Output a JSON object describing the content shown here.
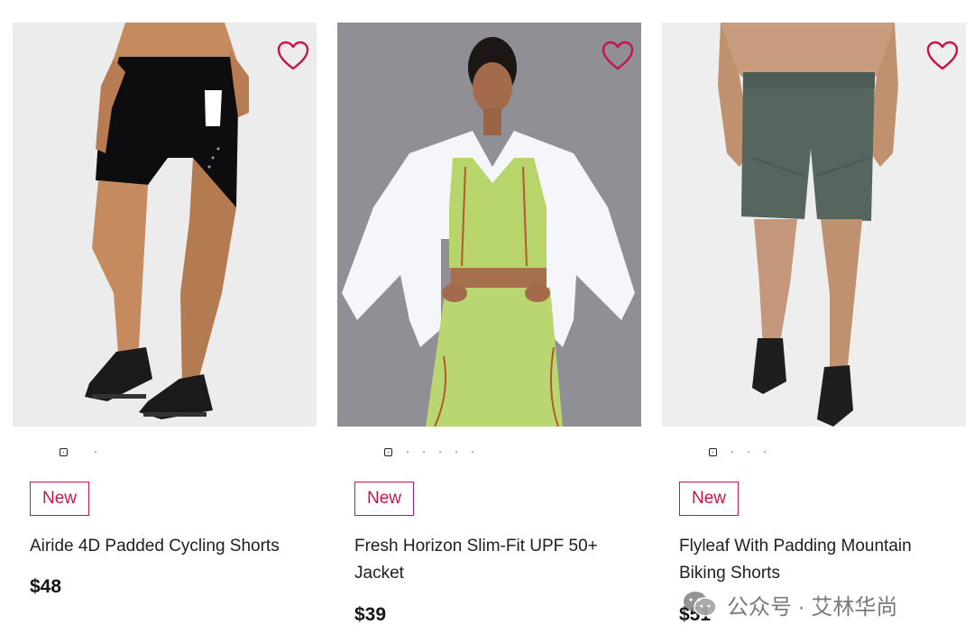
{
  "products": [
    {
      "badge": "New",
      "name": "Airide 4D Padded Cycling Shorts",
      "price": "$48",
      "image_icon": "cycling-shorts-photo",
      "favorite_icon": "heart-outline-icon",
      "color": "#111111"
    },
    {
      "badge": "New",
      "name": "Fresh Horizon Slim-Fit UPF 50+ Jacket",
      "price": "$39",
      "image_icon": "jacket-photo",
      "favorite_icon": "heart-outline-icon",
      "color": "#ffffff"
    },
    {
      "badge": "New",
      "name": "Flyleaf With Padding Mountain Biking Shorts",
      "price": "$51",
      "image_icon": "biking-shorts-photo",
      "favorite_icon": "heart-outline-icon",
      "color": "#55665f"
    }
  ],
  "watermark": {
    "text": "公众号 · 艾林华尚",
    "icon": "wechat-icon"
  },
  "colors": {
    "accent": "#c6154a",
    "text": "#1e1e1e"
  }
}
